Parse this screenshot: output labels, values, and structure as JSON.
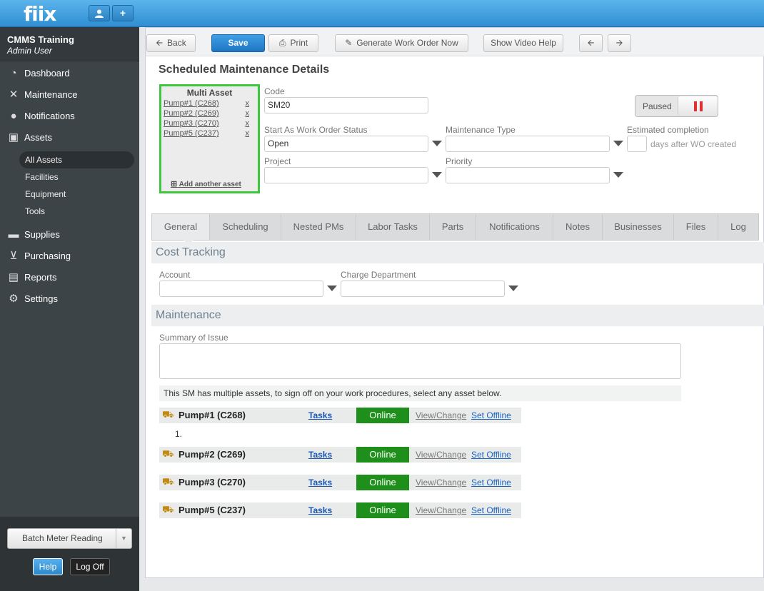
{
  "app": {
    "logo": "fiix"
  },
  "topbar": {
    "user_icon": "user-icon",
    "add_icon": "plus-icon",
    "add_label": "+"
  },
  "org": {
    "name": "CMMS Training",
    "user": "Admin User"
  },
  "nav": [
    {
      "label": "Dashboard",
      "icon": "dashboard-icon",
      "glyph": "◔"
    },
    {
      "label": "Maintenance",
      "icon": "tools-icon",
      "glyph": "✕"
    },
    {
      "label": "Notifications",
      "icon": "chat-icon",
      "glyph": "●"
    },
    {
      "label": "Assets",
      "icon": "box-icon",
      "glyph": "▣"
    }
  ],
  "assets_sub": [
    "All Assets",
    "Facilities",
    "Equipment",
    "Tools"
  ],
  "nav2": [
    {
      "label": "Supplies",
      "icon": "truck-icon",
      "glyph": "▬"
    },
    {
      "label": "Purchasing",
      "icon": "cart-icon",
      "glyph": "⊻"
    },
    {
      "label": "Reports",
      "icon": "chart-icon",
      "glyph": "▤"
    },
    {
      "label": "Settings",
      "icon": "gear-icon",
      "glyph": "⚙"
    }
  ],
  "sidebar_bottom": {
    "batch": "Batch Meter Reading",
    "help": "Help",
    "logoff": "Log Off"
  },
  "toolbar": {
    "back": "Back",
    "save": "Save",
    "print": "Print",
    "generate": "Generate Work Order Now",
    "video": "Show Video Help"
  },
  "page": {
    "title": "Scheduled Maintenance Details"
  },
  "multi_asset": {
    "title": "Multi Asset",
    "assets": [
      "Pump#1 (C268)",
      "Pump#2 (C269)",
      "Pump#3 (C270)",
      "Pump#5 (C237)"
    ],
    "remove": "x",
    "add": "Add another asset"
  },
  "form": {
    "code_label": "Code",
    "code_value": "SM20",
    "status_label": "Start As Work Order Status",
    "status_value": "Open",
    "type_label": "Maintenance Type",
    "type_value": "",
    "completion_label": "Estimated completion",
    "completion_suffix": "days after WO created",
    "project_label": "Project",
    "priority_label": "Priority",
    "paused_label": "Paused"
  },
  "tabs": [
    "General",
    "Scheduling",
    "Nested PMs",
    "Labor Tasks",
    "Parts",
    "Notifications",
    "Notes",
    "Businesses",
    "Files",
    "Log"
  ],
  "cost": {
    "title": "Cost Tracking",
    "account_label": "Account",
    "charge_label": "Charge Department"
  },
  "maintenance": {
    "title": "Maintenance",
    "summary_label": "Summary of Issue",
    "note": "This SM has multiple assets, to sign off on your work procedures, select any asset below.",
    "list_num": "1."
  },
  "asset_rows": [
    {
      "name": "Pump#1 (C268)",
      "tasks": "Tasks",
      "status": "Online",
      "view": "View/Change",
      "offline": "Set Offline"
    },
    {
      "name": "Pump#2 (C269)",
      "tasks": "Tasks",
      "status": "Online",
      "view": "View/Change",
      "offline": "Set Offline"
    },
    {
      "name": "Pump#3 (C270)",
      "tasks": "Tasks",
      "status": "Online",
      "view": "View/Change",
      "offline": "Set Offline"
    },
    {
      "name": "Pump#5 (C237)",
      "tasks": "Tasks",
      "status": "Online",
      "view": "View/Change",
      "offline": "Set Offline"
    }
  ],
  "colors": {
    "online": "#1e8f1a",
    "accent": "#2f8fd2",
    "highlight": "#3ec63e"
  }
}
